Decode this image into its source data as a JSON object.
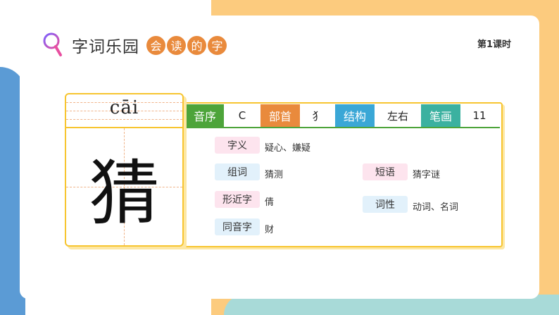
{
  "header": {
    "title": "字词乐园",
    "pills": [
      "会",
      "读",
      "的",
      "字"
    ],
    "lesson": "第1课时"
  },
  "character": {
    "pinyin": "cāi",
    "hanzi": "猜"
  },
  "info_bar": {
    "yinxu_label": "音序",
    "yinxu_value": "C",
    "bushou_label": "部首",
    "bushou_value": "犭",
    "jiegou_label": "结构",
    "jiegou_value": "左右",
    "bihua_label": "笔画",
    "bihua_value": "11"
  },
  "details": {
    "ziyi_label": "字义",
    "ziyi_value": "疑心、嫌疑",
    "zuci_label": "组词",
    "zuci_value": "猜测",
    "duanyu_label": "短语",
    "duanyu_value": "猜字谜",
    "xingjin_label": "形近字",
    "xingjin_value": "倩",
    "cixing_label": "词性",
    "cixing_value": "动词、名词",
    "tongyin_label": "同音字",
    "tongyin_value": "财"
  },
  "colors": {
    "green": "#4da43a",
    "orange": "#e98a3c",
    "blue": "#3aa7d6",
    "teal": "#3bb1a0",
    "yellow_border": "#f7c530"
  },
  "icons": {
    "magnifier": "magnifier-icon"
  }
}
